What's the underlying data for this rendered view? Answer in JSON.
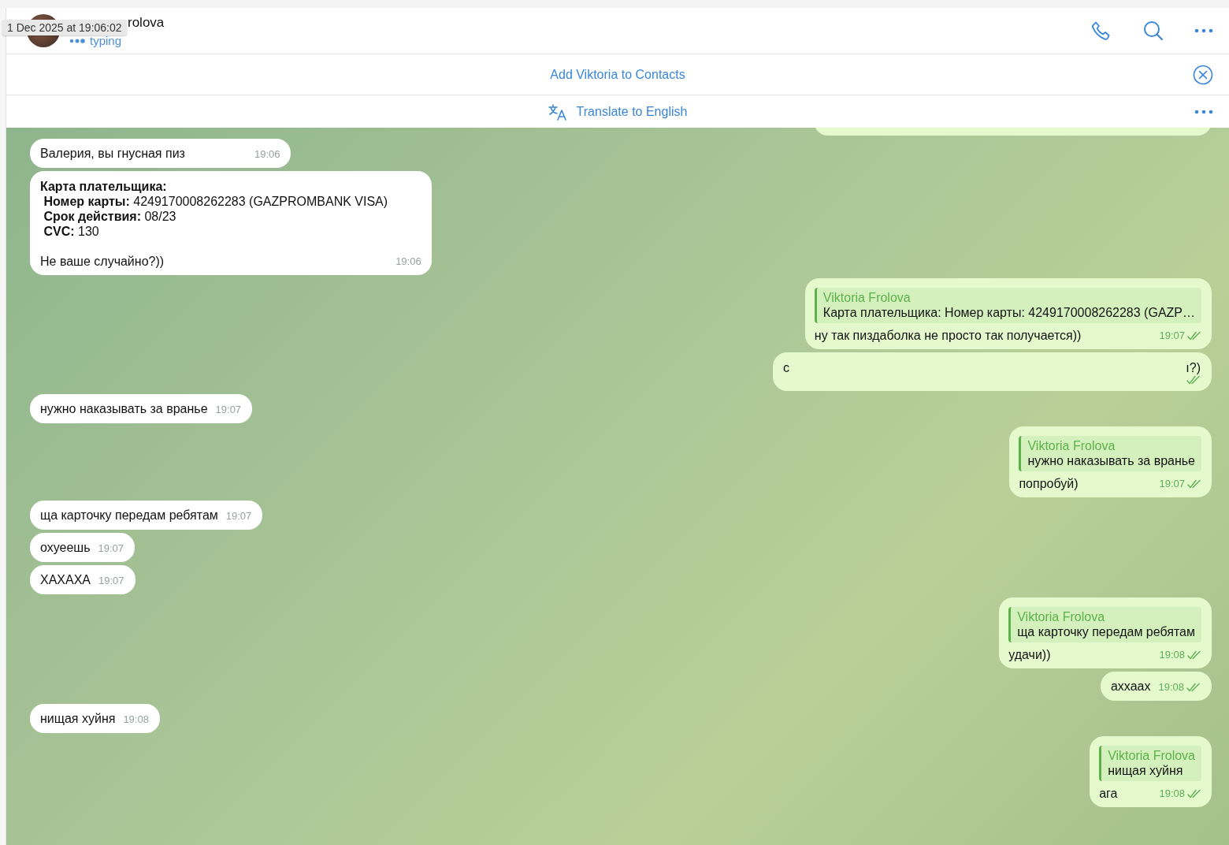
{
  "tooltip": {
    "text": "1 Dec 2025 at 19:06:02"
  },
  "header": {
    "name": "rolova",
    "status": "typing"
  },
  "banner": {
    "label": "Add Viktoria to Contacts"
  },
  "translate_bar": {
    "label": "Translate to English"
  },
  "messages": [
    {
      "kind": "clipped",
      "outgoing": true
    },
    {
      "kind": "partial",
      "outgoing": false,
      "text": "Валерия, вы гнусная пиз",
      "time": "19:06"
    },
    {
      "kind": "block",
      "outgoing": false,
      "text": "**Карта плательщика:**\n **Номер карты:** 4249170008262283 (GAZPROMBANK VISA)\n **Срок действия:** 08/23\n **CVC:** 130\n\nНе ваше случайно?))",
      "time": "19:06"
    },
    {
      "kind": "reply",
      "outgoing": true,
      "reply_name": "Viktoria Frolova",
      "reply_text": "Карта плательщика:  Номер карты: 4249170008262283 (GAZP…",
      "text": "ну так пиздаболка не просто так получается))",
      "time": "19:07",
      "read": true
    },
    {
      "kind": "redacted",
      "outgoing": true,
      "text_start": "с",
      "text_end": "ı?)",
      "read": true
    },
    {
      "kind": "text",
      "outgoing": false,
      "text": "нужно наказывать за вранье",
      "time": "19:07"
    },
    {
      "kind": "reply",
      "outgoing": true,
      "reply_name": "Viktoria Frolova",
      "reply_text": "нужно наказывать за вранье",
      "text": "попробуй)",
      "time": "19:07",
      "read": true
    },
    {
      "kind": "text",
      "outgoing": false,
      "text": "ща карточку передам ребятам",
      "time": "19:07"
    },
    {
      "kind": "text",
      "outgoing": false,
      "text": "охуеешь",
      "time": "19:07"
    },
    {
      "kind": "text",
      "outgoing": false,
      "text": "ХАХАХА",
      "time": "19:07"
    },
    {
      "kind": "reply",
      "outgoing": true,
      "reply_name": "Viktoria Frolova",
      "reply_text": "ща карточку передам ребятам",
      "text": "удачи))",
      "time": "19:08",
      "read": true
    },
    {
      "kind": "text",
      "outgoing": true,
      "text": "аххаах",
      "time": "19:08",
      "read": true
    },
    {
      "kind": "text",
      "outgoing": false,
      "text": "нищая хуйня",
      "time": "19:08"
    },
    {
      "kind": "reply",
      "outgoing": true,
      "reply_name": "Viktoria Frolova",
      "reply_text": "нищая хуйня",
      "text": "ага",
      "time": "19:08",
      "read": true
    }
  ]
}
